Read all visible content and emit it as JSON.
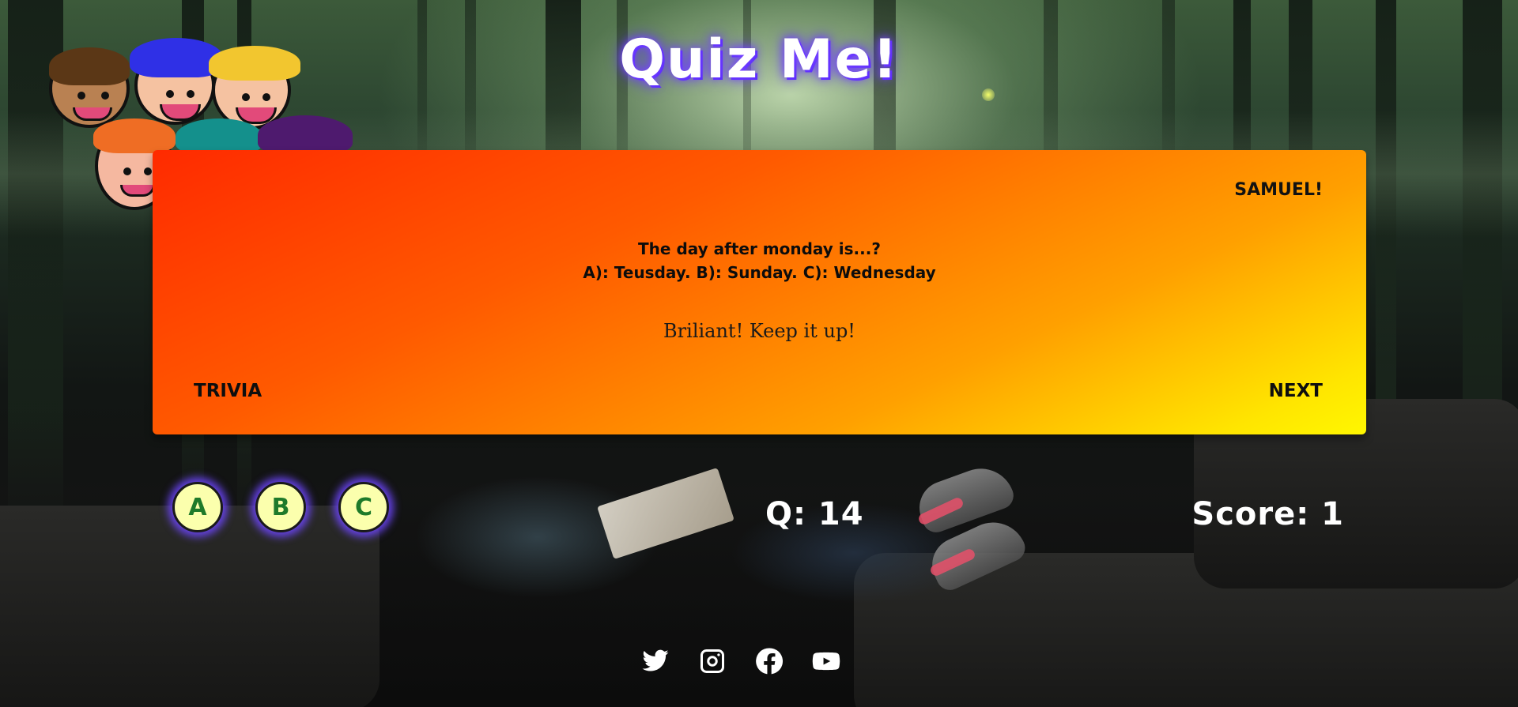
{
  "header": {
    "title": "Quiz Me!"
  },
  "quiz": {
    "player_name": "SAMUEL!",
    "question_line_1": "The day after monday is...?",
    "question_line_2": "A): Teusday. B): Sunday. C): Wednesday",
    "feedback": "Briliant! Keep it up!",
    "trivia_label": "TRIVIA",
    "next_label": "NEXT"
  },
  "answers": {
    "a": "A",
    "b": "B",
    "c": "C"
  },
  "status": {
    "question_counter": "Q: 14",
    "score": "Score: 1"
  },
  "footer": {
    "icons": [
      "twitter-icon",
      "instagram-icon",
      "facebook-icon",
      "youtube-icon"
    ]
  },
  "colors": {
    "card_gradient_start": "#ff2a00",
    "card_gradient_end": "#fff700",
    "answer_fill": "#fbffad",
    "answer_glow": "#6e46ff",
    "answer_letter": "#1e7a2a",
    "title_glow": "#5b2cff"
  }
}
